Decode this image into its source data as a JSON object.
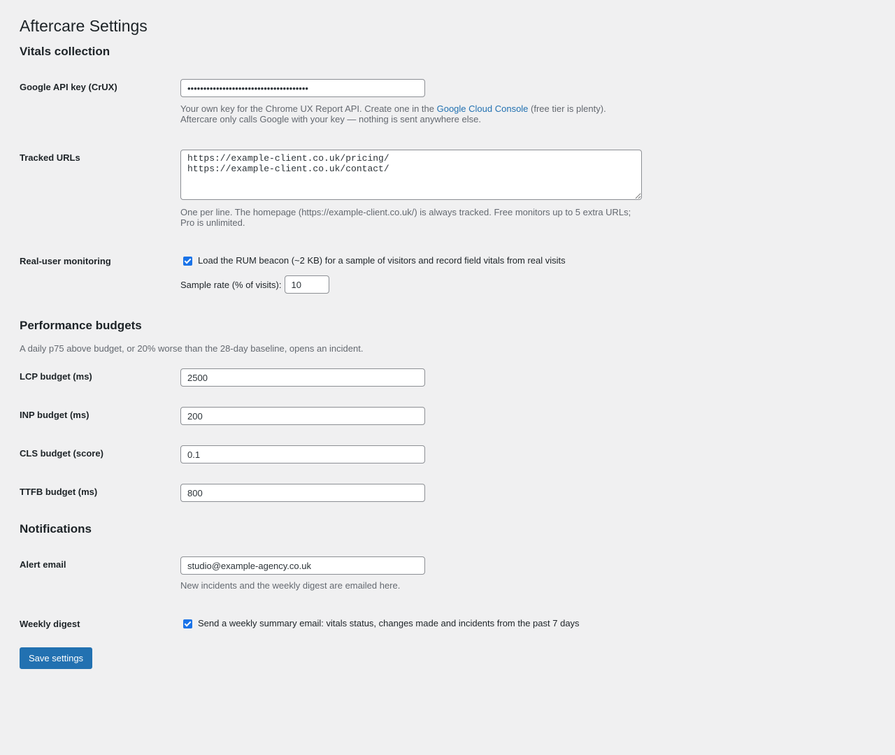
{
  "page": {
    "title": "Aftercare Settings"
  },
  "vitals": {
    "heading": "Vitals collection",
    "api_key": {
      "label": "Google API key (CrUX)",
      "value": "••••••••••••••••••••••••••••••••••••••",
      "desc_prefix": "Your own key for the Chrome UX Report API. Create one in the ",
      "desc_link": "Google Cloud Console",
      "desc_suffix": " (free tier is plenty).",
      "desc_line2": "Aftercare only calls Google with your key — nothing is sent anywhere else."
    },
    "tracked_urls": {
      "label": "Tracked URLs",
      "value": "https://example-client.co.uk/pricing/\nhttps://example-client.co.uk/contact/",
      "desc_line1": "One per line. The homepage (https://example-client.co.uk/) is always tracked. Free monitors up to 5 extra URLs;",
      "desc_line2": "Pro is unlimited."
    },
    "rum": {
      "label": "Real-user monitoring",
      "checked": true,
      "checkbox_label": "Load the RUM beacon (~2 KB) for a sample of visitors and record field vitals from real visits",
      "sample_label": "Sample rate (% of visits):",
      "sample_value": "10"
    }
  },
  "budgets": {
    "heading": "Performance budgets",
    "desc": "A daily p75 above budget, or 20% worse than the 28-day baseline, opens an incident.",
    "lcp": {
      "label": "LCP budget (ms)",
      "value": "2500"
    },
    "inp": {
      "label": "INP budget (ms)",
      "value": "200"
    },
    "cls": {
      "label": "CLS budget (score)",
      "value": "0.1"
    },
    "ttfb": {
      "label": "TTFB budget (ms)",
      "value": "800"
    }
  },
  "notifications": {
    "heading": "Notifications",
    "alert_email": {
      "label": "Alert email",
      "value": "studio@example-agency.co.uk",
      "desc": "New incidents and the weekly digest are emailed here."
    },
    "weekly_digest": {
      "label": "Weekly digest",
      "checked": true,
      "checkbox_label": "Send a weekly summary email: vitals status, changes made and incidents from the past 7 days"
    }
  },
  "actions": {
    "save_label": "Save settings"
  },
  "colors": {
    "accent": "#2271b1",
    "background": "#f0f0f1",
    "checkbox": "#1a73e8",
    "muted_text": "#646970"
  }
}
